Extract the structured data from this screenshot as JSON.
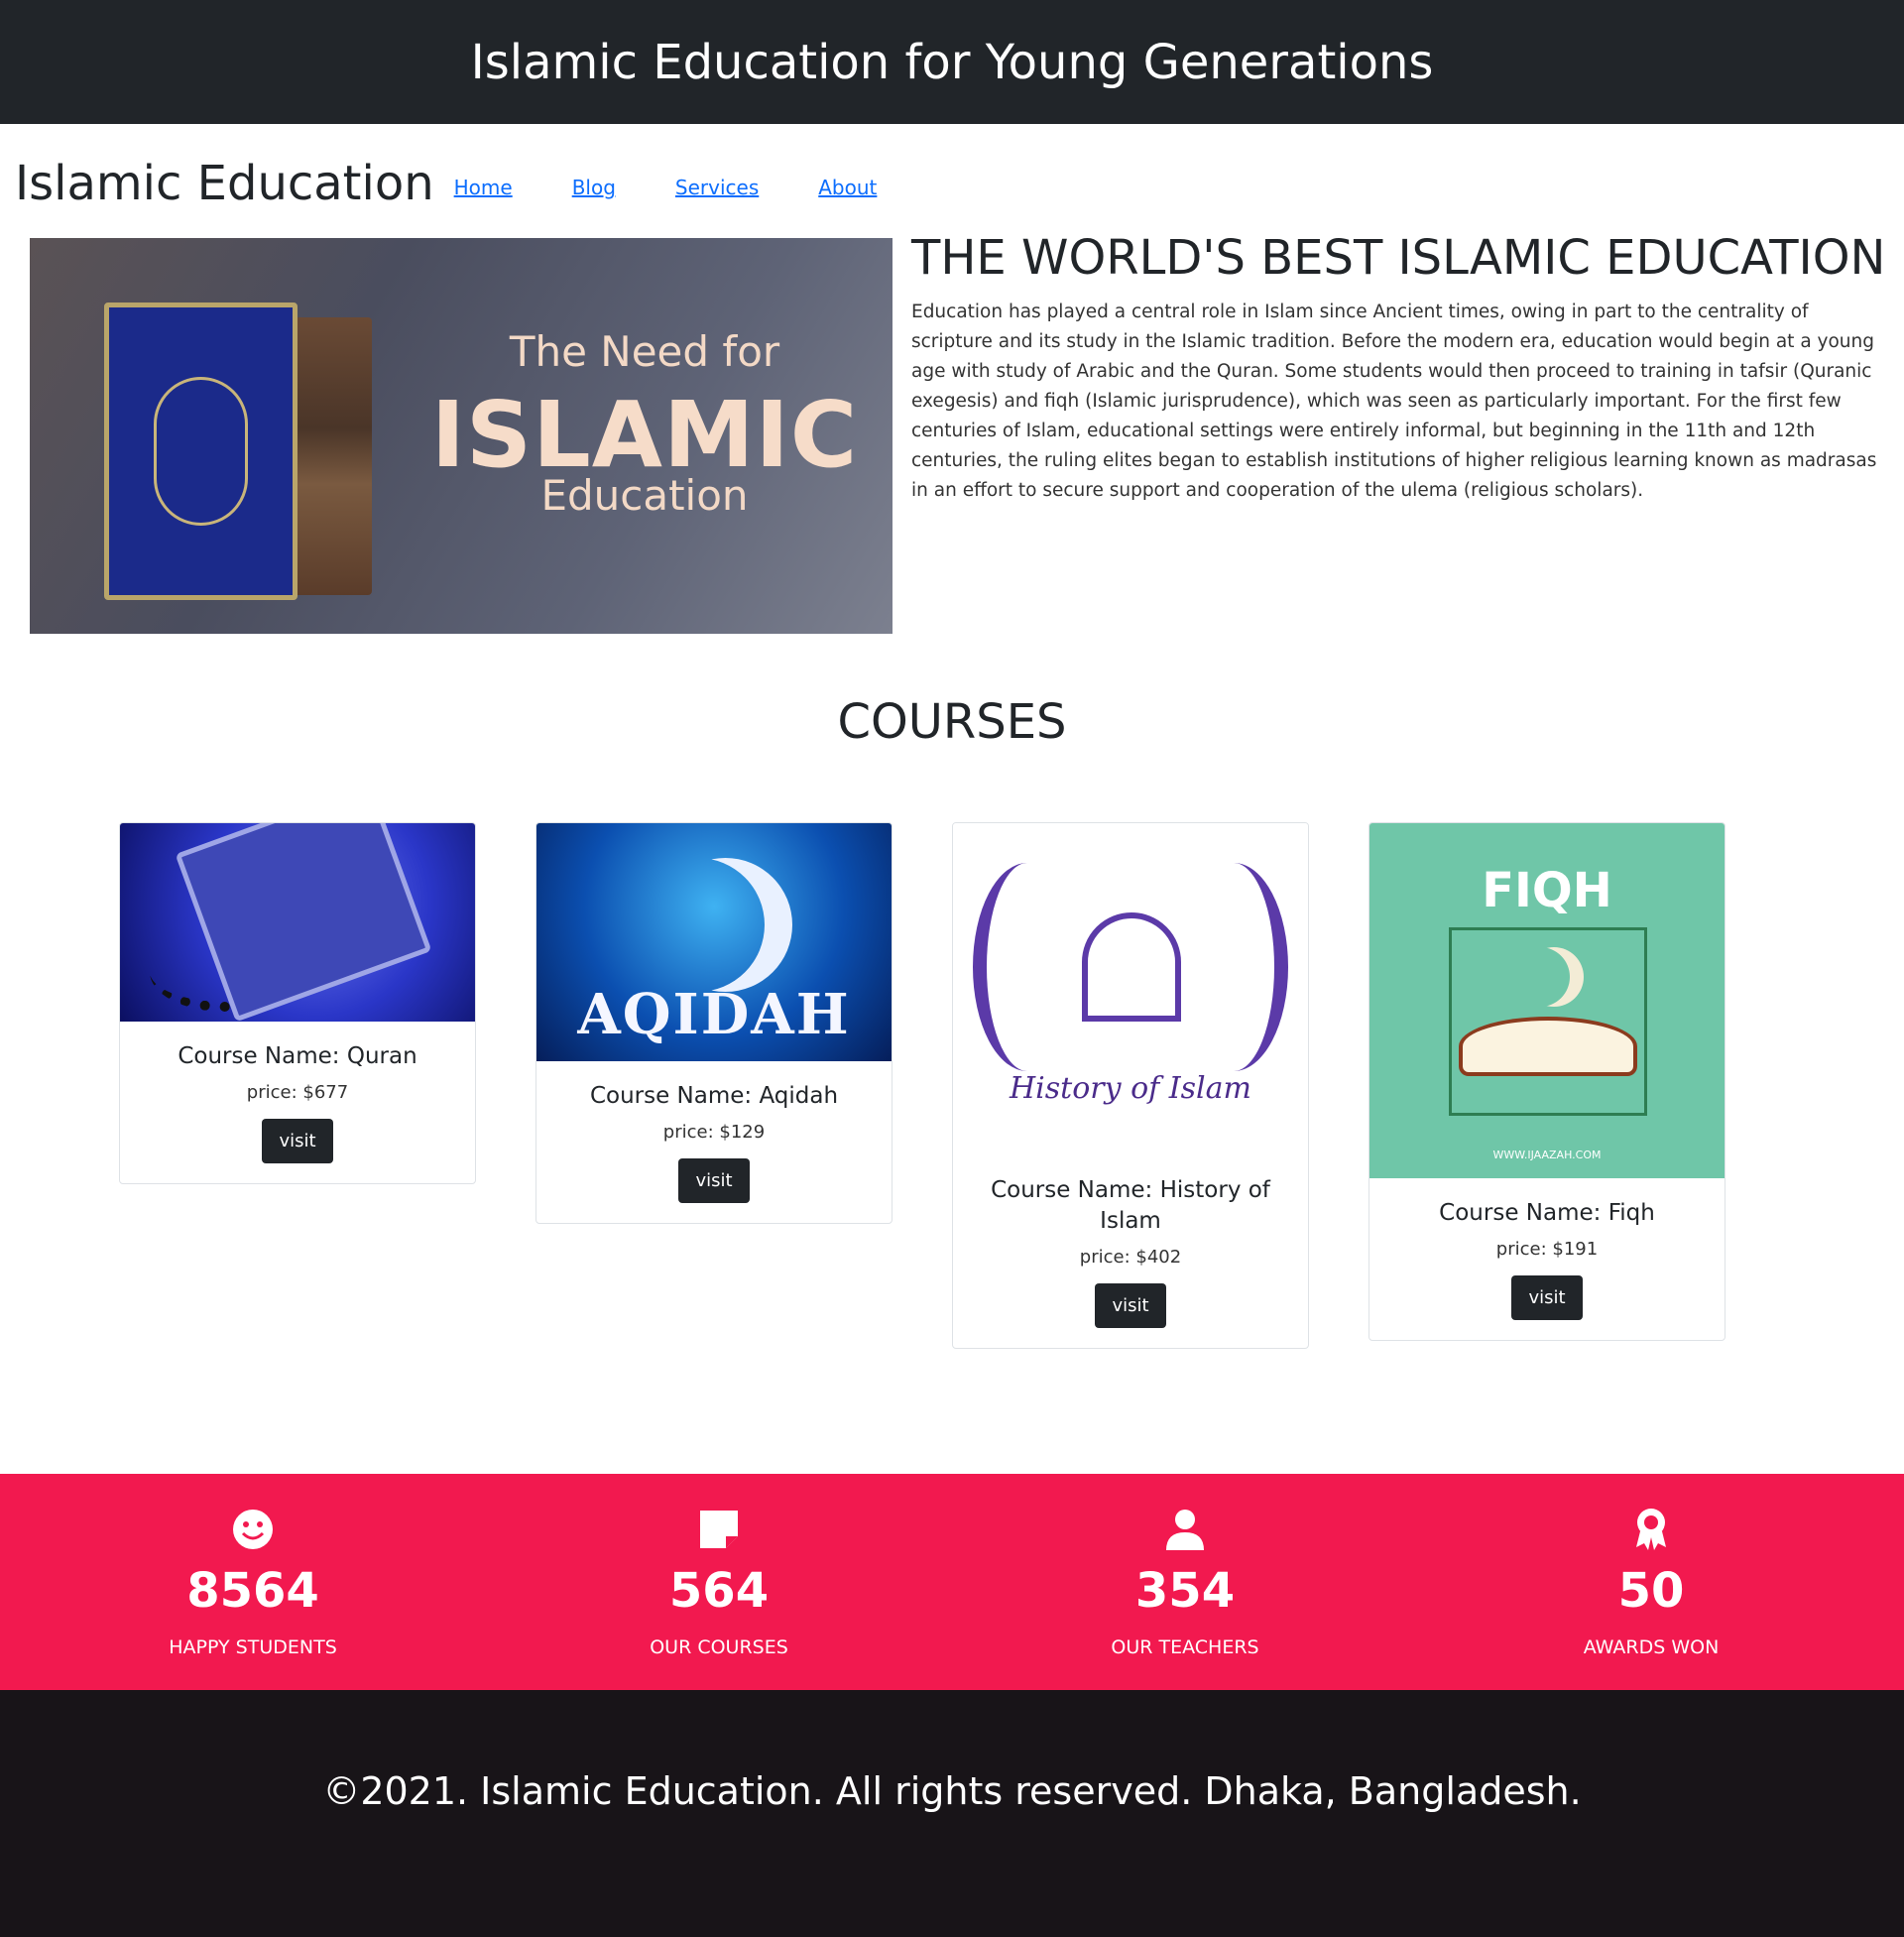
{
  "top_banner": {
    "title": "Islamic Education for Young Generations"
  },
  "navbar": {
    "brand": "Islamic Education",
    "links": [
      "Home",
      "Blog",
      "Services",
      "About"
    ]
  },
  "hero": {
    "image_text": {
      "line1": "The Need for",
      "line2": "ISLAMIC",
      "line3": "Education"
    },
    "title": "THE WORLD'S BEST ISLAMIC EDUCATION",
    "paragraph": "Education has played a central role in Islam since Ancient times, owing in part to the centrality of scripture and its study in the Islamic tradition. Before the modern era, education would begin at a young age with study of Arabic and the Quran. Some students would then proceed to training in tafsir (Quranic exegesis) and fiqh (Islamic jurisprudence), which was seen as particularly important. For the first few centuries of Islam, educational settings were entirely informal, but beginning in the 11th and 12th centuries, the ruling elites began to establish institutions of higher religious learning known as madrasas in an effort to secure support and cooperation of the ulema (religious scholars)."
  },
  "courses": {
    "title": "COURSES",
    "items": [
      {
        "name": "Course Name: Quran",
        "price": "price: $677",
        "button": "visit",
        "image_text": ""
      },
      {
        "name": "Course Name: Aqidah",
        "price": "price: $129",
        "button": "visit",
        "image_text": "AQIDAH"
      },
      {
        "name": "Course Name: History of Islam",
        "price": "price: $402",
        "button": "visit",
        "image_text": "History of Islam"
      },
      {
        "name": "Course Name: Fiqh",
        "price": "price: $191",
        "button": "visit",
        "image_text": "FIQH",
        "image_url_text": "WWW.IJAAZAH.COM"
      }
    ]
  },
  "stats": {
    "background_color": "#f2194f",
    "items": [
      {
        "icon": "smile-icon",
        "number": "8564",
        "label": "HAPPY STUDENTS"
      },
      {
        "icon": "note-icon",
        "number": "564",
        "label": "OUR COURSES"
      },
      {
        "icon": "person-icon",
        "number": "354",
        "label": "OUR TEACHERS"
      },
      {
        "icon": "award-icon",
        "number": "50",
        "label": "AWARDS WON"
      }
    ]
  },
  "footer": {
    "text": "©2021. Islamic Education. All rights reserved. Dhaka, Bangladesh."
  }
}
